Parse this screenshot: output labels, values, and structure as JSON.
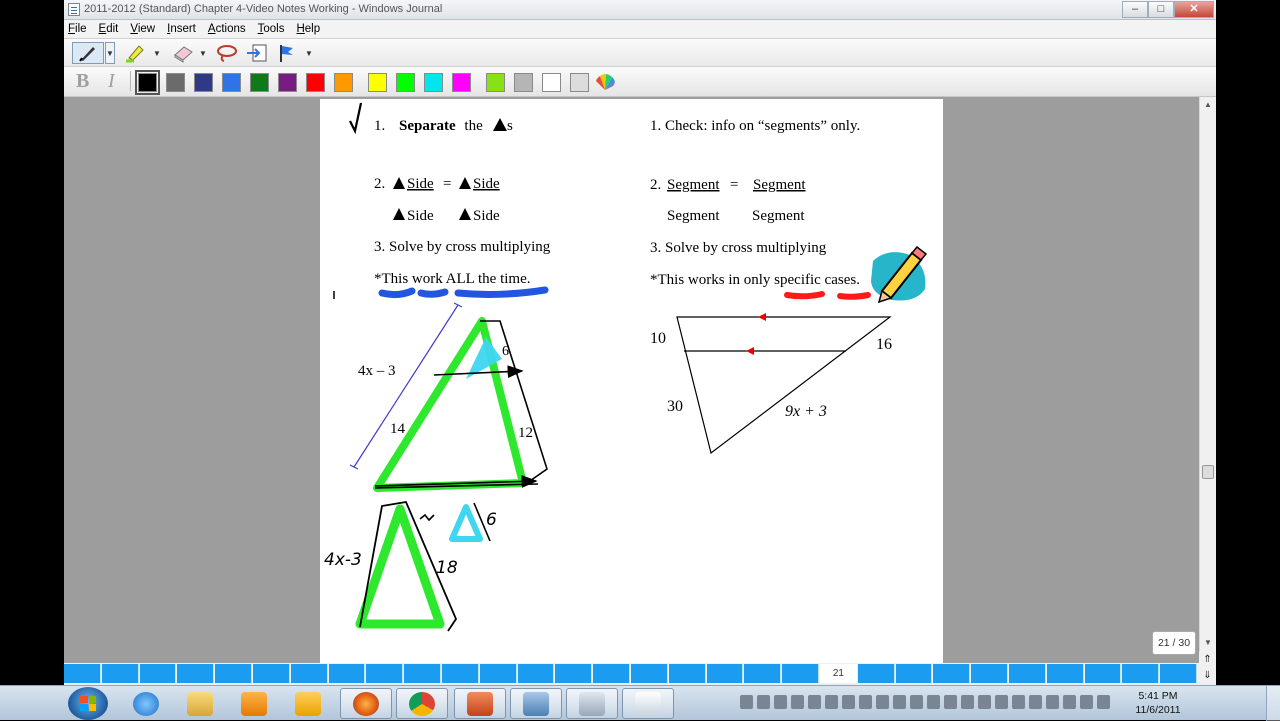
{
  "window": {
    "title": "2011-2012 (Standard) Chapter 4-Video Notes Working - Windows Journal",
    "controls": {
      "minimize": "–",
      "maximize": "□",
      "close": "✕"
    }
  },
  "menu": [
    "File",
    "Edit",
    "View",
    "Insert",
    "Actions",
    "Tools",
    "Help"
  ],
  "toolbar": {
    "tools": [
      "pen-icon",
      "highlighter-icon",
      "eraser-icon",
      "lasso-icon",
      "insert-space-icon",
      "flag-icon"
    ],
    "format": {
      "bold": "B",
      "italic": "I"
    },
    "colors": [
      "#000000",
      "#6b6b6b",
      "#2e3a87",
      "#2f73e6",
      "#0f7a1a",
      "#7a1a84",
      "#ff0000",
      "#ff9900",
      "#ffff00",
      "#00ff00",
      "#00e5ee",
      "#ff00ff",
      "#88e01a",
      "#b5b5b5",
      "#ffffff",
      "#dcdcdc"
    ],
    "selected_color": "#000000"
  },
  "note": {
    "left": {
      "step1_num": "1.",
      "step1_bold": "Separate",
      "step1_rest": "the",
      "step1_suffix": "s",
      "step2_num": "2.",
      "side": "Side",
      "equals": "=",
      "step3": "3. Solve by cross multiplying",
      "note": "*This work ALL the time."
    },
    "right": {
      "step1": "1. Check: info on “segments” only.",
      "step2_num": "2.",
      "segment": "Segment",
      "equals": "=",
      "step3": "3. Solve by cross multiplying",
      "note": "*This works in only specific cases."
    },
    "fig1": {
      "side_label": "4x – 3",
      "label_14": "14",
      "label_6": "6",
      "label_12": "12"
    },
    "fig1b": {
      "label_4x3": "4x-3",
      "label_18": "18",
      "label_6": "6"
    },
    "fig2": {
      "label_10": "10",
      "label_16": "16",
      "label_30": "30",
      "label_9x3": "9x + 3"
    }
  },
  "pages": {
    "current": "21",
    "indicator": "21 / 30"
  },
  "taskbar": {
    "apps": [
      "start-button",
      "internet-explorer-icon",
      "folder-icon",
      "media-player-icon",
      "outlook-icon",
      "firefox-icon",
      "chrome-icon",
      "powerpoint-icon",
      "journal-icon",
      "calculator-icon",
      "paint-icon"
    ],
    "time": "5:41 PM",
    "date": "11/6/2011"
  }
}
